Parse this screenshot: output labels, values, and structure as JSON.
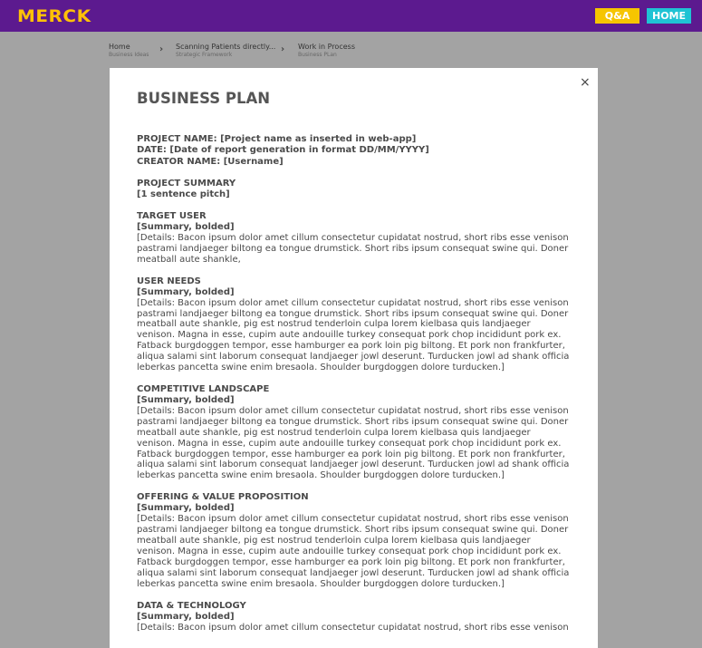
{
  "topbar": {
    "logo": "MERCK",
    "qa_label": "Q&A",
    "home_label": "HOME"
  },
  "breadcrumb": [
    {
      "title": "Home",
      "subtitle": "Business Ideas"
    },
    {
      "title": "Scanning Patients directly...",
      "subtitle": "Strategic Framework"
    },
    {
      "title": "Work in Process",
      "subtitle": "Business PLan"
    }
  ],
  "modal": {
    "close": "×",
    "heading": "BUSINESS PLAN",
    "header_lines": [
      "PROJECT NAME: [Project name as inserted in web-app]",
      "DATE: [Date of report generation in format DD/MM/YYYY]",
      "CREATOR NAME: [Username]"
    ],
    "summary": {
      "title": "PROJECT SUMMARY",
      "text": "[1 sentence pitch]"
    },
    "sections": [
      {
        "title": "TARGET USER",
        "summary": "[Summary, bolded]",
        "detail": "[Details: Bacon ipsum dolor amet cillum consectetur cupidatat nostrud, short ribs esse venison pastrami landjaeger biltong ea tongue drumstick. Short ribs ipsum consequat swine qui. Doner meatball aute shankle,"
      },
      {
        "title": "USER NEEDS",
        "summary": "[Summary, bolded]",
        "detail": "[Details: Bacon ipsum dolor amet cillum consectetur cupidatat nostrud, short ribs esse venison pastrami landjaeger biltong ea tongue drumstick. Short ribs ipsum consequat swine qui. Doner meatball aute shankle, pig est nostrud tenderloin culpa lorem kielbasa quis landjaeger venison. Magna in esse, cupim aute andouille turkey consequat pork chop incididunt pork ex.\nFatback burgdoggen tempor, esse hamburger ea pork loin pig biltong. Et pork non frankfurter, aliqua salami sint laborum consequat landjaeger jowl deserunt. Turducken jowl ad shank officia leberkas pancetta swine enim bresaola. Shoulder burgdoggen dolore turducken.]"
      },
      {
        "title": "COMPETITIVE LANDSCAPE",
        "summary": "[Summary, bolded]",
        "detail": "[Details: Bacon ipsum dolor amet cillum consectetur cupidatat nostrud, short ribs esse venison pastrami landjaeger biltong ea tongue drumstick. Short ribs ipsum consequat swine qui. Doner meatball aute shankle, pig est nostrud tenderloin culpa lorem kielbasa quis landjaeger venison. Magna in esse, cupim aute andouille turkey consequat pork chop incididunt pork ex.\nFatback burgdoggen tempor, esse hamburger ea pork loin pig biltong. Et pork non frankfurter, aliqua salami sint laborum consequat landjaeger jowl deserunt. Turducken jowl ad shank officia leberkas pancetta swine enim bresaola. Shoulder burgdoggen dolore turducken.]"
      },
      {
        "title": "OFFERING & VALUE PROPOSITION",
        "summary": "[Summary, bolded]",
        "detail": "[Details: Bacon ipsum dolor amet cillum consectetur cupidatat nostrud, short ribs esse venison pastrami landjaeger biltong ea tongue drumstick. Short ribs ipsum consequat swine qui. Doner meatball aute shankle, pig est nostrud tenderloin culpa lorem kielbasa quis landjaeger venison. Magna in esse, cupim aute andouille turkey consequat pork chop incididunt pork ex.\nFatback burgdoggen tempor, esse hamburger ea pork loin pig biltong. Et pork non frankfurter, aliqua salami sint laborum consequat landjaeger jowl deserunt. Turducken jowl ad shank officia leberkas pancetta swine enim bresaola. Shoulder burgdoggen dolore turducken.]"
      },
      {
        "title": "DATA & TECHNOLOGY",
        "summary": "[Summary, bolded]",
        "detail": "[Details: Bacon ipsum dolor amet cillum consectetur cupidatat nostrud, short ribs esse venison"
      }
    ]
  },
  "colors": {
    "topbar": "#5c1a8f",
    "logo": "#ffc107",
    "qa": "#f6c500",
    "home": "#1fc3d4",
    "overlay": "#a3a3a3"
  }
}
